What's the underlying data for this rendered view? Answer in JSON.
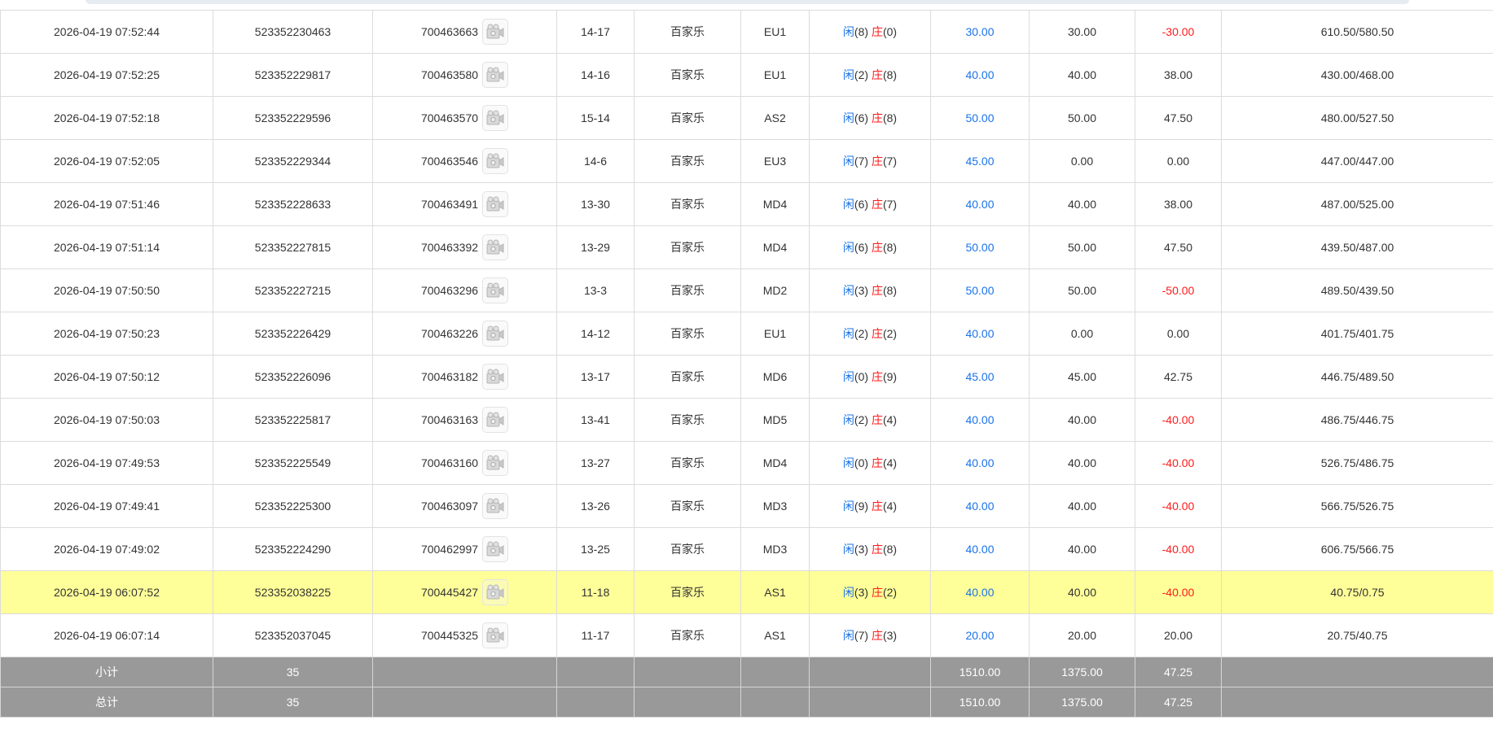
{
  "rows": [
    {
      "time": "2026-04-19 07:52:44",
      "order_id": "523352230463",
      "round_id": "700463663",
      "shoe": "14-17",
      "game": "百家乐",
      "table": "EU1",
      "player_label": "闲",
      "player_val": "(8)",
      "banker_label": "庄",
      "banker_val": "(0)",
      "bet": "30.00",
      "valid_bet": "30.00",
      "win_loss": "-30.00",
      "win_loss_negative": true,
      "balance": "610.50/580.50",
      "highlight": false
    },
    {
      "time": "2026-04-19 07:52:25",
      "order_id": "523352229817",
      "round_id": "700463580",
      "shoe": "14-16",
      "game": "百家乐",
      "table": "EU1",
      "player_label": "闲",
      "player_val": "(2)",
      "banker_label": "庄",
      "banker_val": "(8)",
      "bet": "40.00",
      "valid_bet": "40.00",
      "win_loss": "38.00",
      "win_loss_negative": false,
      "balance": "430.00/468.00",
      "highlight": false
    },
    {
      "time": "2026-04-19 07:52:18",
      "order_id": "523352229596",
      "round_id": "700463570",
      "shoe": "15-14",
      "game": "百家乐",
      "table": "AS2",
      "player_label": "闲",
      "player_val": "(6)",
      "banker_label": "庄",
      "banker_val": "(8)",
      "bet": "50.00",
      "valid_bet": "50.00",
      "win_loss": "47.50",
      "win_loss_negative": false,
      "balance": "480.00/527.50",
      "highlight": false
    },
    {
      "time": "2026-04-19 07:52:05",
      "order_id": "523352229344",
      "round_id": "700463546",
      "shoe": "14-6",
      "game": "百家乐",
      "table": "EU3",
      "player_label": "闲",
      "player_val": "(7)",
      "banker_label": "庄",
      "banker_val": "(7)",
      "bet": "45.00",
      "valid_bet": "0.00",
      "win_loss": "0.00",
      "win_loss_negative": false,
      "balance": "447.00/447.00",
      "highlight": false
    },
    {
      "time": "2026-04-19 07:51:46",
      "order_id": "523352228633",
      "round_id": "700463491",
      "shoe": "13-30",
      "game": "百家乐",
      "table": "MD4",
      "player_label": "闲",
      "player_val": "(6)",
      "banker_label": "庄",
      "banker_val": "(7)",
      "bet": "40.00",
      "valid_bet": "40.00",
      "win_loss": "38.00",
      "win_loss_negative": false,
      "balance": "487.00/525.00",
      "highlight": false
    },
    {
      "time": "2026-04-19 07:51:14",
      "order_id": "523352227815",
      "round_id": "700463392",
      "shoe": "13-29",
      "game": "百家乐",
      "table": "MD4",
      "player_label": "闲",
      "player_val": "(6)",
      "banker_label": "庄",
      "banker_val": "(8)",
      "bet": "50.00",
      "valid_bet": "50.00",
      "win_loss": "47.50",
      "win_loss_negative": false,
      "balance": "439.50/487.00",
      "highlight": false
    },
    {
      "time": "2026-04-19 07:50:50",
      "order_id": "523352227215",
      "round_id": "700463296",
      "shoe": "13-3",
      "game": "百家乐",
      "table": "MD2",
      "player_label": "闲",
      "player_val": "(3)",
      "banker_label": "庄",
      "banker_val": "(8)",
      "bet": "50.00",
      "valid_bet": "50.00",
      "win_loss": "-50.00",
      "win_loss_negative": true,
      "balance": "489.50/439.50",
      "highlight": false
    },
    {
      "time": "2026-04-19 07:50:23",
      "order_id": "523352226429",
      "round_id": "700463226",
      "shoe": "14-12",
      "game": "百家乐",
      "table": "EU1",
      "player_label": "闲",
      "player_val": "(2)",
      "banker_label": "庄",
      "banker_val": "(2)",
      "bet": "40.00",
      "valid_bet": "0.00",
      "win_loss": "0.00",
      "win_loss_negative": false,
      "balance": "401.75/401.75",
      "highlight": false
    },
    {
      "time": "2026-04-19 07:50:12",
      "order_id": "523352226096",
      "round_id": "700463182",
      "shoe": "13-17",
      "game": "百家乐",
      "table": "MD6",
      "player_label": "闲",
      "player_val": "(0)",
      "banker_label": "庄",
      "banker_val": "(9)",
      "bet": "45.00",
      "valid_bet": "45.00",
      "win_loss": "42.75",
      "win_loss_negative": false,
      "balance": "446.75/489.50",
      "highlight": false
    },
    {
      "time": "2026-04-19 07:50:03",
      "order_id": "523352225817",
      "round_id": "700463163",
      "shoe": "13-41",
      "game": "百家乐",
      "table": "MD5",
      "player_label": "闲",
      "player_val": "(2)",
      "banker_label": "庄",
      "banker_val": "(4)",
      "bet": "40.00",
      "valid_bet": "40.00",
      "win_loss": "-40.00",
      "win_loss_negative": true,
      "balance": "486.75/446.75",
      "highlight": false
    },
    {
      "time": "2026-04-19 07:49:53",
      "order_id": "523352225549",
      "round_id": "700463160",
      "shoe": "13-27",
      "game": "百家乐",
      "table": "MD4",
      "player_label": "闲",
      "player_val": "(0)",
      "banker_label": "庄",
      "banker_val": "(4)",
      "bet": "40.00",
      "valid_bet": "40.00",
      "win_loss": "-40.00",
      "win_loss_negative": true,
      "balance": "526.75/486.75",
      "highlight": false
    },
    {
      "time": "2026-04-19 07:49:41",
      "order_id": "523352225300",
      "round_id": "700463097",
      "shoe": "13-26",
      "game": "百家乐",
      "table": "MD3",
      "player_label": "闲",
      "player_val": "(9)",
      "banker_label": "庄",
      "banker_val": "(4)",
      "bet": "40.00",
      "valid_bet": "40.00",
      "win_loss": "-40.00",
      "win_loss_negative": true,
      "balance": "566.75/526.75",
      "highlight": false
    },
    {
      "time": "2026-04-19 07:49:02",
      "order_id": "523352224290",
      "round_id": "700462997",
      "shoe": "13-25",
      "game": "百家乐",
      "table": "MD3",
      "player_label": "闲",
      "player_val": "(3)",
      "banker_label": "庄",
      "banker_val": "(8)",
      "bet": "40.00",
      "valid_bet": "40.00",
      "win_loss": "-40.00",
      "win_loss_negative": true,
      "balance": "606.75/566.75",
      "highlight": false
    },
    {
      "time": "2026-04-19 06:07:52",
      "order_id": "523352038225",
      "round_id": "700445427",
      "shoe": "11-18",
      "game": "百家乐",
      "table": "AS1",
      "player_label": "闲",
      "player_val": "(3)",
      "banker_label": "庄",
      "banker_val": "(2)",
      "bet": "40.00",
      "valid_bet": "40.00",
      "win_loss": "-40.00",
      "win_loss_negative": true,
      "balance": "40.75/0.75",
      "highlight": true
    },
    {
      "time": "2026-04-19 06:07:14",
      "order_id": "523352037045",
      "round_id": "700445325",
      "shoe": "11-17",
      "game": "百家乐",
      "table": "AS1",
      "player_label": "闲",
      "player_val": "(7)",
      "banker_label": "庄",
      "banker_val": "(3)",
      "bet": "20.00",
      "valid_bet": "20.00",
      "win_loss": "20.00",
      "win_loss_negative": false,
      "balance": "20.75/40.75",
      "highlight": false
    }
  ],
  "summary": [
    {
      "label": "小计",
      "count": "35",
      "bet": "1510.00",
      "valid_bet": "1375.00",
      "win_loss": "47.25"
    },
    {
      "label": "总计",
      "count": "35",
      "bet": "1510.00",
      "valid_bet": "1375.00",
      "win_loss": "47.25"
    }
  ],
  "colors": {
    "player": "#1a73e8",
    "banker": "#ff1a1a",
    "negative": "#ff1a1a",
    "bet": "#1a73e8",
    "highlight_row": "#ffff99",
    "summary_row": "#999999"
  },
  "icons": {
    "round_detail": "video-replay-icon"
  }
}
